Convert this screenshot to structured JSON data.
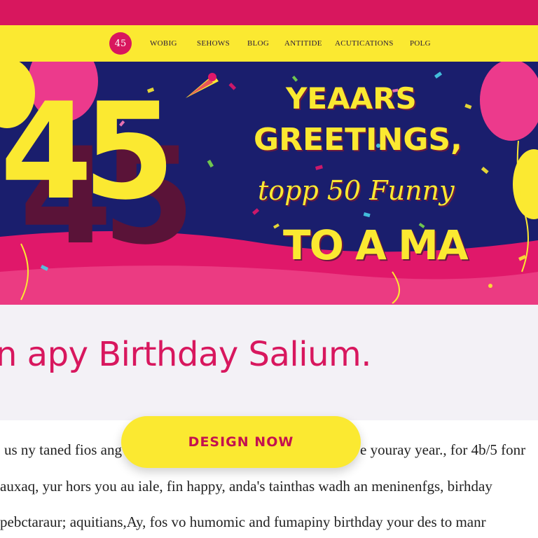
{
  "logo": {
    "text": "45"
  },
  "nav": {
    "items": [
      "WOBIG",
      "SEHOWS",
      "BLOG",
      "ANTITIDE",
      "ACUTICATIONS",
      "POLG"
    ]
  },
  "hero": {
    "big_number": "45",
    "line1": "YEAARS",
    "line2": "GREETINGS,",
    "line3": "topp 50 Funny",
    "line4": "TO A MA"
  },
  "subtitle": "n apy Birthday Salium.",
  "cta": {
    "label": "DESIGN NOW"
  },
  "body": {
    "line1_left": "us ny taned fios ang",
    "line1_right": "e youray year., for 4b/5 fonr",
    "line2": "auxaq, yur hors you au iale, fin happy, anda's tainthas wadh an meninenfgs, birhday",
    "line3": "pebctaraur; aquitians,Ay, fos vo humomic and fumapiny birthday your des to manr"
  },
  "colors": {
    "pink": "#d8175e",
    "yellow": "#fbe931",
    "navy": "#1a1e6d"
  }
}
